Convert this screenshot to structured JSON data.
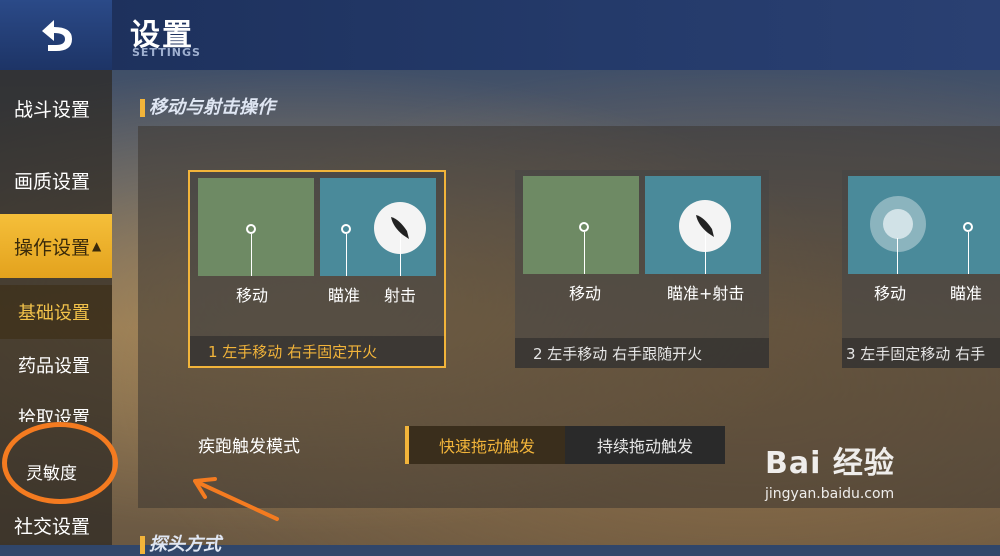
{
  "header": {
    "title": "设置",
    "subtitle": "SETTINGS"
  },
  "sidebar": {
    "items": [
      {
        "label": "战斗设置"
      },
      {
        "label": "画质设置"
      },
      {
        "label": "操作设置",
        "caret": "▲"
      }
    ],
    "subitems": [
      {
        "label": "基础设置"
      },
      {
        "label": "药品设置"
      },
      {
        "label": "拾取设置"
      },
      {
        "label": "灵敏度"
      }
    ],
    "last_item": {
      "label": "社交设置"
    }
  },
  "section": {
    "title": "移动与射击操作",
    "next_title": "探头方式"
  },
  "cards": [
    {
      "footer": "1 左手移动 右手固定开火",
      "labels": [
        "移动",
        "瞄准",
        "射击"
      ]
    },
    {
      "footer": "2 左手移动 右手跟随开火",
      "labels": [
        "移动",
        "瞄准+射击"
      ]
    },
    {
      "footer": "3 左手固定移动 右手",
      "labels": [
        "移动",
        "瞄准"
      ]
    }
  ],
  "sprint": {
    "label": "疾跑触发模式",
    "options": [
      "快速拖动触发",
      "持续拖动触发"
    ],
    "selected": "快速拖动触发"
  },
  "watermark": {
    "main": "Bai 经验",
    "sub": "jingyan.baidu.com"
  },
  "colors": {
    "accent": "#f2b43a",
    "annotation": "#f47b20"
  }
}
